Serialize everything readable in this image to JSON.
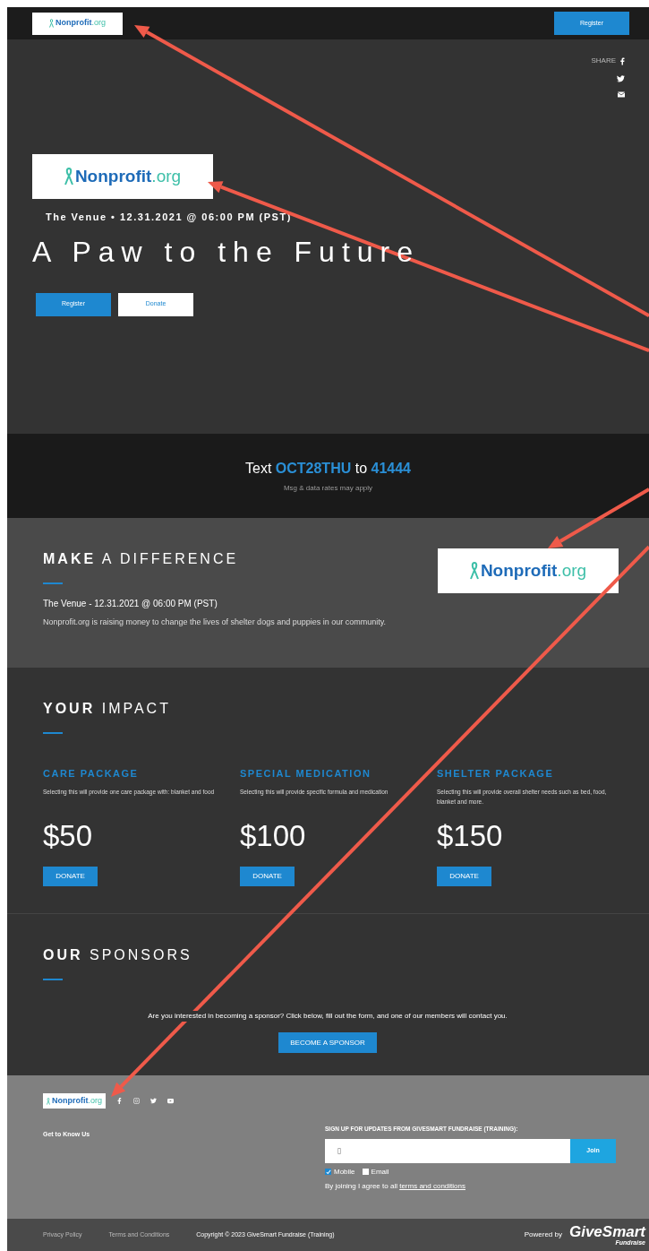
{
  "header": {
    "logo": {
      "name": "Nonprofit",
      "suffix": ".org"
    },
    "button": "Register"
  },
  "hero": {
    "share_label": "SHARE",
    "logo": {
      "name": "Nonprofit",
      "suffix": ".org"
    },
    "subtitle": "The Venue • 12.31.2021 @ 06:00 PM (PST)",
    "title": "A Paw to the Future",
    "buttons": [
      {
        "label": "Register",
        "kind": "primary"
      },
      {
        "label": "Donate",
        "kind": "secondary"
      }
    ]
  },
  "text_to_give": {
    "message": "Text **OCT28THU** to **41444**",
    "note": "Msg & data rates may apply"
  },
  "about": {
    "heading_bold": "MAKE",
    "heading_rest": "A DIFFERENCE",
    "date": "The Venue - 12.31.2021 @ 06:00 PM (PST)",
    "description": "Nonprofit.org is raising money to change the lives of shelter dogs and puppies in our community.",
    "logo": {
      "name": "Nonprofit",
      "suffix": ".org"
    }
  },
  "impact": {
    "heading_bold": "YOUR",
    "heading_rest": "IMPACT",
    "items": [
      {
        "title": "CARE PACKAGE",
        "description": "Selecting this will provide one care package with: blanket and food",
        "amount": "$50",
        "button": "DONATE"
      },
      {
        "title": "SPECIAL MEDICATION",
        "description": "Selecting this will provide specific formula and medication",
        "amount": "$100",
        "button": "DONATE"
      },
      {
        "title": "SHELTER PACKAGE",
        "description": "Selecting this will provide overall shelter needs such as bed, food, blanket and more.",
        "amount": "$150",
        "button": "DONATE"
      }
    ]
  },
  "sponsors": {
    "heading_bold": "OUR",
    "heading_rest": "SPONSORS",
    "text": "Are you interested in becoming a sponsor? Click below, fill out the form, and one of our members will contact you.",
    "button": "BECOME A SPONSOR"
  },
  "footer": {
    "logo": {
      "name": "Nonprofit",
      "suffix": ".org"
    },
    "link": "Get to Know Us",
    "signup_title": "SIGN UP FOR UPDATES FROM GIVESMART FUNDRAISE (TRAINING):",
    "join": "Join",
    "options": [
      {
        "label": "Mobile",
        "checked": true
      },
      {
        "label": "Email",
        "checked": false
      }
    ],
    "agree": "By joining I agree to all",
    "agree_link": "terms and conditions"
  },
  "bottom_bar": {
    "links": [
      "Privacy Policy",
      "Terms and Conditions"
    ],
    "copyright": "Copyright © 2023 GiveSmart Fundraise (Training)",
    "powered_by": "Powered by",
    "brand": "GiveSmart",
    "brand_sub": "Fundraise"
  }
}
